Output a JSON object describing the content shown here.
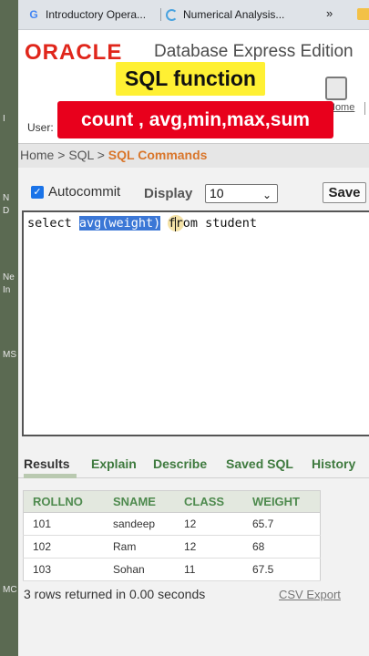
{
  "browser": {
    "tabs": [
      {
        "label": "Introductory Opera...",
        "icon": "google-g-icon"
      },
      {
        "label": "Numerical Analysis...",
        "icon": "loading-icon"
      }
    ],
    "more": "»"
  },
  "left_strip": [
    "I",
    "N",
    "D",
    "Ne",
    "In",
    "MS",
    "MC"
  ],
  "header": {
    "logo": "ORACLE",
    "product": "Database Express Edition",
    "user_label": "User:",
    "home_link": "Home"
  },
  "overlay": {
    "title": "SQL function",
    "subtitle": "count , avg,min,max,sum"
  },
  "breadcrumb": {
    "home": "Home",
    "sep": " > ",
    "sql": "SQL",
    "current": "SQL Commands"
  },
  "toolbar": {
    "autocommit_label": "Autocommit",
    "autocommit_checked": true,
    "display_label": "Display",
    "display_value": "10",
    "save_label": "Save"
  },
  "editor": {
    "before": "select ",
    "selected": "avg(weight)",
    "after": " from student"
  },
  "result_tabs": [
    {
      "label": "Results",
      "active": true
    },
    {
      "label": "Explain",
      "active": false
    },
    {
      "label": "Describe",
      "active": false
    },
    {
      "label": "Saved SQL",
      "active": false
    },
    {
      "label": "History",
      "active": false
    }
  ],
  "results": {
    "columns": [
      "ROLLNO",
      "SNAME",
      "CLASS",
      "WEIGHT"
    ],
    "rows": [
      [
        "101",
        "sandeep",
        "12",
        "65.7"
      ],
      [
        "102",
        "Ram",
        "12",
        "68"
      ],
      [
        "103",
        "Sohan",
        "11",
        "67.5"
      ]
    ],
    "status": "3 rows returned in 0.00 seconds",
    "csv_export": "CSV Export"
  },
  "colors": {
    "oracle_red": "#e0261b",
    "breadcrumb_current": "#d9762b",
    "tab_green": "#3e7a3e",
    "header_green": "#4e8a4e",
    "overlay_yellow": "#fff033",
    "overlay_red": "#e8001c",
    "selection_blue": "#3b77d6"
  }
}
